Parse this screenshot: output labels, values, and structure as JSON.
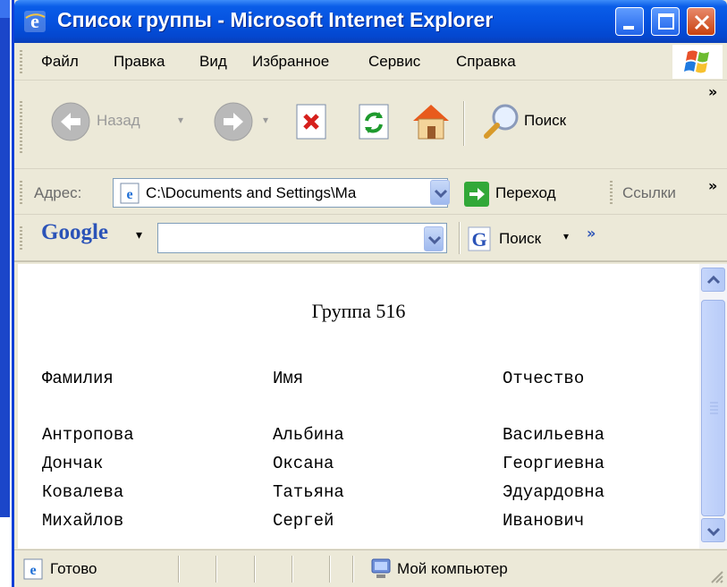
{
  "window": {
    "title": "Список группы - Microsoft Internet Explorer"
  },
  "menu": {
    "items": [
      "Файл",
      "Правка",
      "Вид",
      "Избранное",
      "Сервис",
      "Справка"
    ]
  },
  "toolbar": {
    "back_label": "Назад",
    "search_label": "Поиск"
  },
  "address": {
    "label": "Адрес:",
    "value": "C:\\Documents and Settings\\Ma",
    "go_label": "Переход",
    "links_label": "Ссылки"
  },
  "google": {
    "logo": "Google",
    "search_label": "Поиск",
    "query": ""
  },
  "document": {
    "title": "Группа 516",
    "headers": [
      "Фамилия",
      "Имя",
      "Отчество"
    ],
    "rows": [
      [
        "Антропова",
        "Альбина",
        "Васильевна"
      ],
      [
        "Дончак",
        "Оксана",
        "Георгиевна"
      ],
      [
        "Ковалева",
        "Татьяна",
        "Эдуардовна"
      ],
      [
        "Михайлов",
        "Сергей",
        "Иванович"
      ]
    ]
  },
  "status": {
    "text": "Готово",
    "zone": "Мой компьютер"
  },
  "colors": {
    "titlebar": "#0552e0",
    "chrome": "#ece9d8",
    "content": "#ffffff"
  }
}
